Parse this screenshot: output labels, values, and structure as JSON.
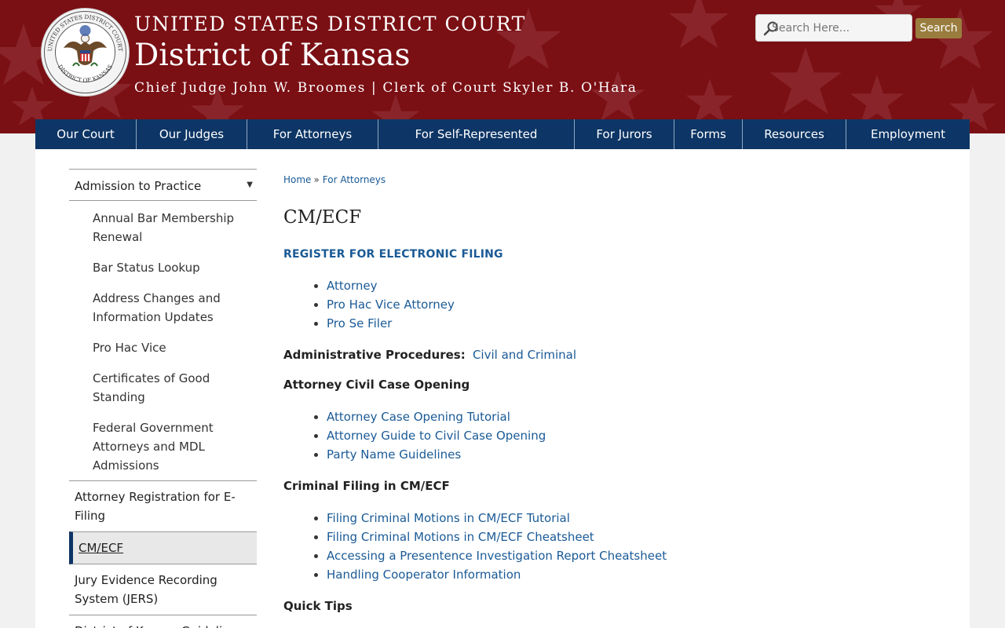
{
  "header": {
    "line1": "UNITED STATES DISTRICT COURT",
    "line2": "District of Kansas",
    "line3": "Chief Judge John W. Broomes | Clerk of Court Skyler B. O'Hara",
    "seal_ring_top": "UNITED STATES DISTRICT COURT",
    "seal_ring_bottom": "DISTRICT OF KANSAS"
  },
  "search": {
    "placeholder": "Search Here...",
    "button": "Search"
  },
  "nav": [
    "Our Court",
    "Our Judges",
    "For Attorneys",
    "For Self-Represented",
    "For Jurors",
    "Forms",
    "Resources",
    "Employment"
  ],
  "sidebar": {
    "top": "Admission to Practice",
    "sub_items": [
      "Annual Bar Membership Renewal",
      "Bar Status Lookup",
      "Address Changes and Information Updates",
      "Pro Hac Vice",
      "Certificates of Good Standing",
      "Federal Government Attorneys and MDL Admissions"
    ],
    "items": [
      "Attorney Registration for E-Filing",
      "CM/ECF",
      "Jury Evidence Recording System (JERS)",
      "District of Kansas Guidelines"
    ]
  },
  "breadcrumb": [
    "Home",
    "For Attorneys"
  ],
  "breadcrumb_sep": "»",
  "title": "CM/ECF",
  "register_heading": "REGISTER FOR ELECTRONIC FILING",
  "register_links": [
    "Attorney",
    "Pro Hac Vice Attorney",
    "Pro Se Filer"
  ],
  "admin_label": "Administrative Procedures:",
  "admin_link": "Civil and Criminal",
  "civil_heading": "Attorney Civil Case Opening",
  "civil_links": [
    "Attorney Case Opening Tutorial",
    "Attorney Guide to Civil Case Opening",
    "Party Name Guidelines"
  ],
  "criminal_heading": "Criminal Filing in CM/ECF",
  "criminal_links": [
    "Filing Criminal Motions in CM/ECF Tutorial",
    "Filing Criminal Motions in CM/ECF Cheatsheet",
    "Accessing a Presentence Investigation Report Cheatsheet",
    "Handling Cooperator Information"
  ],
  "quick_tips_heading": "Quick Tips",
  "colors": {
    "header_bg": "#7a0f14",
    "nav_bg": "#0d3565",
    "link": "#1a5a96",
    "search_button": "#9a7d3e"
  }
}
